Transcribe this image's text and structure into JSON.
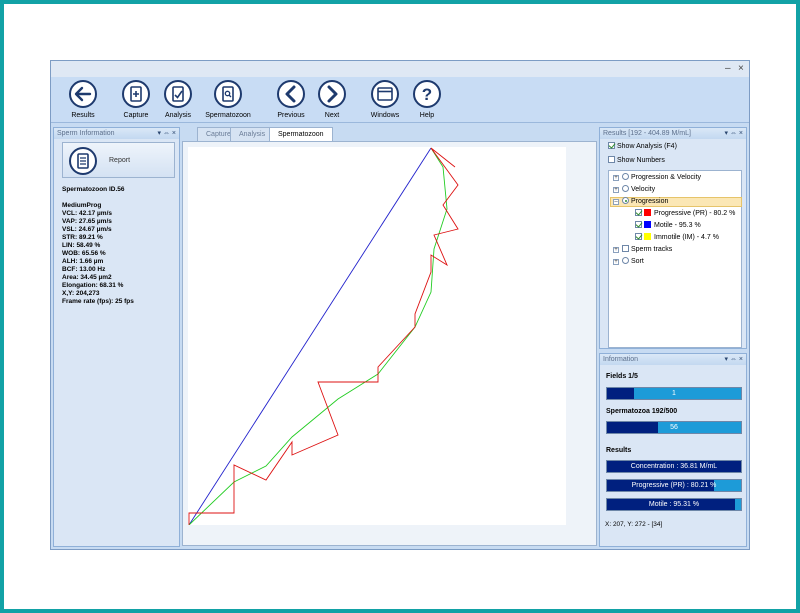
{
  "window": {
    "minimize": "–",
    "close": "×"
  },
  "toolbar": {
    "results": "Results",
    "capture": "Capture",
    "analysis": "Analysis",
    "spermatozoon": "Spermatozoon",
    "previous": "Previous",
    "next": "Next",
    "windows": "Windows",
    "help": "Help"
  },
  "sperm_info": {
    "title": "Sperm Information",
    "report_label": "Report",
    "id": "Spermatozoon ID.56",
    "classification": "MediumProg",
    "metrics": [
      "VCL: 42.17 µm/s",
      "VAP: 27.65 µm/s",
      "VSL: 24.67 µm/s",
      "STR: 89.21 %",
      "LIN: 58.49 %",
      "WOB: 65.56 %",
      "ALH: 1.66 µm",
      "BCF: 13.00 Hz",
      "Area: 34.45 µm2",
      "Elongation: 68.31 %",
      "X,Y: 204,273",
      "Frame rate (fps): 25 fps"
    ]
  },
  "tabs": {
    "capture": "Capture",
    "analysis": "Analysis",
    "spermatozoon": "Spermatozoon"
  },
  "results_pane": {
    "title": "Results [192 - 404.89 M/mL]",
    "show_analysis": "Show Analysis (F4)",
    "show_numbers": "Show Numbers",
    "tree": {
      "progression_velocity": "Progression & Velocity",
      "velocity": "Velocity",
      "progression": "Progression",
      "progressive": "Progressive (PR) - 80.2 %",
      "motile": "Motile - 95.3 %",
      "immotile": "Immotile (IM) - 4.7 %",
      "sperm_tracks": "Sperm tracks",
      "sort": "Sort"
    },
    "colors": {
      "progressive": "#ff0000",
      "motile": "#0000ff",
      "immotile": "#ffff00"
    }
  },
  "information": {
    "title": "Information",
    "fields_label": "Fields 1/5",
    "fields_value": "1",
    "fields_fraction": 0.2,
    "spermatozoa_label": "Spermatozoa 192/500",
    "spermatozoa_value": "56",
    "spermatozoa_fraction": 0.38,
    "results_label": "Results",
    "concentration": "Concentration : 36.81 M/mL",
    "concentration_fraction": 1.0,
    "progressive": "Progressive (PR) : 80.21 %",
    "progressive_fraction": 0.8021,
    "motile": "Motile : 95.31 %",
    "motile_fraction": 0.9531,
    "coords": "X: 207, Y: 272 - [34]"
  }
}
